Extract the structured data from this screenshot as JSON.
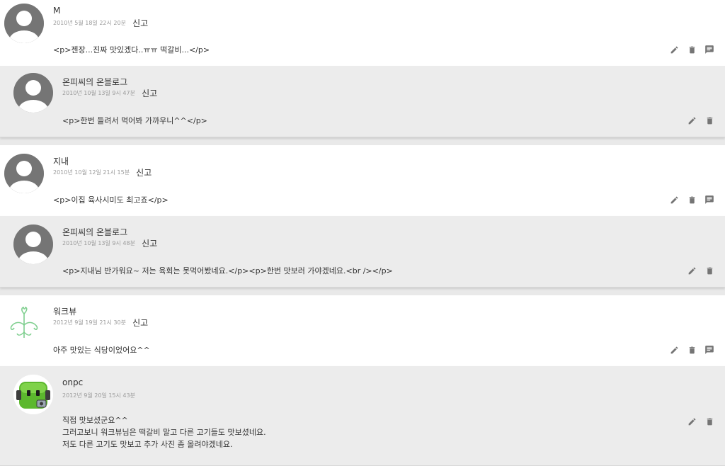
{
  "report_label": "신고",
  "threads": [
    {
      "comment": {
        "author": "M",
        "date": "2010년 5월 18일 22시 20분",
        "text": "<p>젠장...진짜 맛있겠다..ㅠㅠ 떡갈비...</p>"
      },
      "reply": {
        "author": "온피씨의 온블로그",
        "date": "2010년 10월 13일 9시 47분",
        "text": "<p>한번 들려서 먹어봐 가까우니^^</p>"
      }
    },
    {
      "comment": {
        "author": "지내",
        "date": "2010년 10월 12일 21시 15분",
        "text": "<p>이집 육사시미도 최고죠</p>"
      },
      "reply": {
        "author": "온피씨의 온블로그",
        "date": "2010년 10월 13일 9시 48분",
        "text": "<p>지내님 반가워요~ 저는 육회는 못먹어봤네요.</p><p>한번 맛보러 가야겠네요.<br /></p>"
      }
    },
    {
      "comment": {
        "author": "워크뷰",
        "date": "2012년 9월 19일 21시 30분",
        "text": "아주 맛있는 식당이었어요^^"
      },
      "reply": {
        "author": "onpc",
        "date": "2012년 9월 20일 15시 43분",
        "text": "직접 맛보셨군요^^\n그러고보니 워크뷰님은 떡갈비 말고 다른 고기들도 맛보셨네요.\n저도 다른 고기도 맛보고 추가 사진 좀 올려야겠네요."
      }
    }
  ],
  "icons": [
    "edit-icon",
    "delete-icon",
    "reply-icon",
    "default-avatar-icon",
    "flower-avatar",
    "robot-avatar"
  ]
}
